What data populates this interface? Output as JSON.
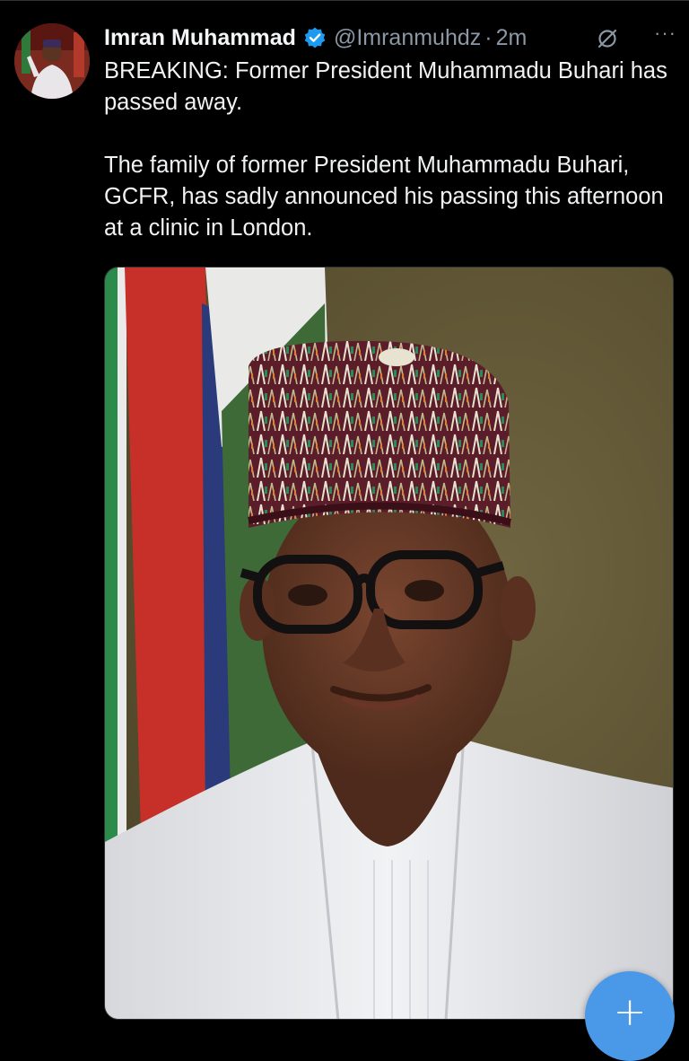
{
  "post": {
    "author_name": "Imran Muhammad",
    "handle": "@Imranmuhdz",
    "separator": "·",
    "time_ago": "2m",
    "more_label": "···",
    "paragraphs": [
      "BREAKING: Former President Muhammadu Buhari has passed away.",
      "The family of former President Muhammadu Buhari, GCFR, has sadly announced his passing this afternoon at a clinic in London."
    ]
  },
  "fab": {
    "label": "+"
  },
  "colors": {
    "background": "#000000",
    "verified": "#1d9bf0",
    "fab": "#4a99e9",
    "muted_text": "#8b98a5"
  },
  "icons": [
    "verified-badge-icon",
    "grok-icon",
    "more-icon",
    "compose-plus-icon"
  ]
}
